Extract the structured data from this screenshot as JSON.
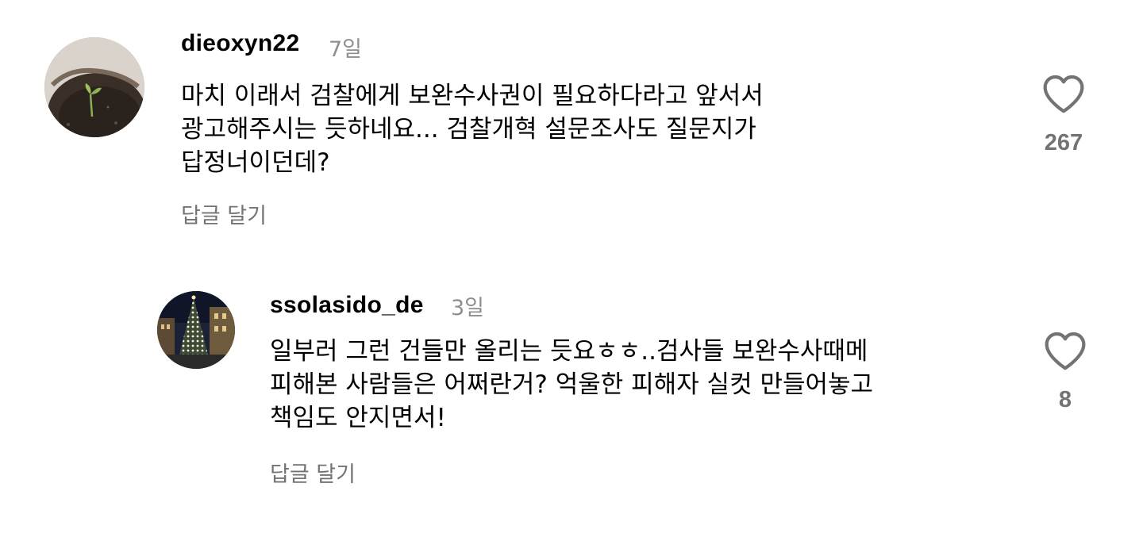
{
  "comments": [
    {
      "username": "dieoxyn22",
      "time": "7일",
      "lines": [
        "마치 이래서 검찰에게 보완수사권이 필요하다라고 앞서서",
        "광고해주시는 듯하네요... 검찰개혁 설문조사도 질문지가",
        "답정너이던데?"
      ],
      "reply_label": "답글 달기",
      "likes": "267"
    },
    {
      "username": "ssolasido_de",
      "time": "3일",
      "lines": [
        "일부러 그런 건들만 올리는 듯요ㅎㅎ..검사들 보완수사때메",
        "피해본 사람들은 어쩌란거? 억울한 피해자 실컷 만들어놓고",
        "책임도 안지면서!"
      ],
      "reply_label": "답글 달기",
      "likes": "8"
    }
  ],
  "icons": {
    "like": "heart-outline-icon"
  }
}
